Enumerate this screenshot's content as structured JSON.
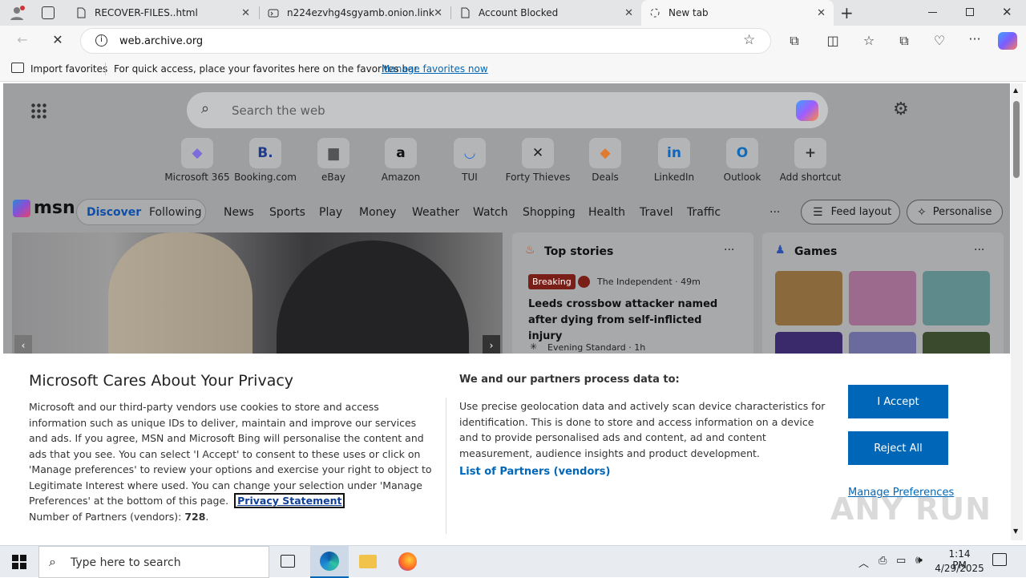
{
  "tabs": [
    {
      "title": "RECOVER-FILES..html",
      "icon": "document-icon"
    },
    {
      "title": "n224ezvhg4sgyamb.onion.link",
      "icon": "tor-icon"
    },
    {
      "title": "Account Blocked",
      "icon": "document-icon"
    },
    {
      "title": "New tab",
      "icon": "loading-icon"
    }
  ],
  "address": {
    "url": "web.archive.org"
  },
  "favorites": {
    "import_label": "Import favorites",
    "hint": "For quick access, place your favorites here on the favorites bar.",
    "manage_link": "Manage favorites now"
  },
  "newtab": {
    "search_placeholder": "Search the web",
    "shortcuts": [
      {
        "label": "Microsoft 365",
        "glyph": "◆",
        "color": "#7b6cd9"
      },
      {
        "label": "Booking.com",
        "glyph": "B.",
        "color": "#1f3a8f"
      },
      {
        "label": "eBay",
        "glyph": "▆",
        "color": "#555"
      },
      {
        "label": "Amazon",
        "glyph": "a",
        "color": "#111"
      },
      {
        "label": "TUI",
        "glyph": "◡",
        "color": "#2b6fd6"
      },
      {
        "label": "Forty Thieves",
        "glyph": "✕",
        "color": "#222"
      },
      {
        "label": "Deals",
        "glyph": "◆",
        "color": "#e07a2e"
      },
      {
        "label": "LinkedIn",
        "glyph": "in",
        "color": "#0a66c2"
      },
      {
        "label": "Outlook",
        "glyph": "O",
        "color": "#0f6cbd"
      },
      {
        "label": "Add shortcut",
        "glyph": "+",
        "color": "#333"
      }
    ]
  },
  "msn": {
    "logo": "msn",
    "nav_pills": [
      "Discover",
      "Following"
    ],
    "nav_items": [
      "News",
      "Sports",
      "Play",
      "Money",
      "Weather",
      "Watch",
      "Shopping",
      "Health",
      "Travel",
      "Traffic"
    ],
    "more": "···",
    "feed_layout": "Feed layout",
    "personalise": "Personalise",
    "top_stories": {
      "title": "Top stories",
      "more": "···",
      "badge": "Breaking",
      "source1": "The Independent · 49m",
      "headline": "Leeds crossbow attacker named after dying from self-inflicted injury",
      "source2": "Evening Standard · 1h"
    },
    "games": {
      "title": "Games",
      "more": "···"
    }
  },
  "privacy": {
    "title": "Microsoft Cares About Your Privacy",
    "body": "Microsoft and our third-party vendors use cookies to store and access information such as unique IDs to deliver, maintain and improve our services and ads. If you agree, MSN and Microsoft Bing will personalise the content and ads that you see. You can select 'I Accept' to consent to these uses or click on 'Manage preferences' to review your options and exercise your right to object to Legitimate Interest where used.  You can change your selection under 'Manage Preferences' at the bottom of this page.",
    "privacy_link": "Privacy Statement",
    "partners_label": "Number of Partners (vendors): ",
    "partners_count": "728",
    "partners_suffix": ".",
    "process_title": "We and our partners process data to:",
    "process_body": "Use precise geolocation data and actively scan device characteristics for identification. This is done to store and access information on a device and to provide personalised ads and content, ad and content measurement, audience insights and product development.",
    "list_link": "List of Partners (vendors)",
    "accept": "I Accept",
    "reject": "Reject All",
    "manage": "Manage Preferences"
  },
  "taskbar": {
    "search_placeholder": "Type here to search",
    "time": "1:14 PM",
    "date": "4/29/2025"
  },
  "watermark": "ANY RUN",
  "colors": {
    "accent": "#0067b8",
    "breaking": "#c42b1c",
    "link": "#0067b8"
  }
}
